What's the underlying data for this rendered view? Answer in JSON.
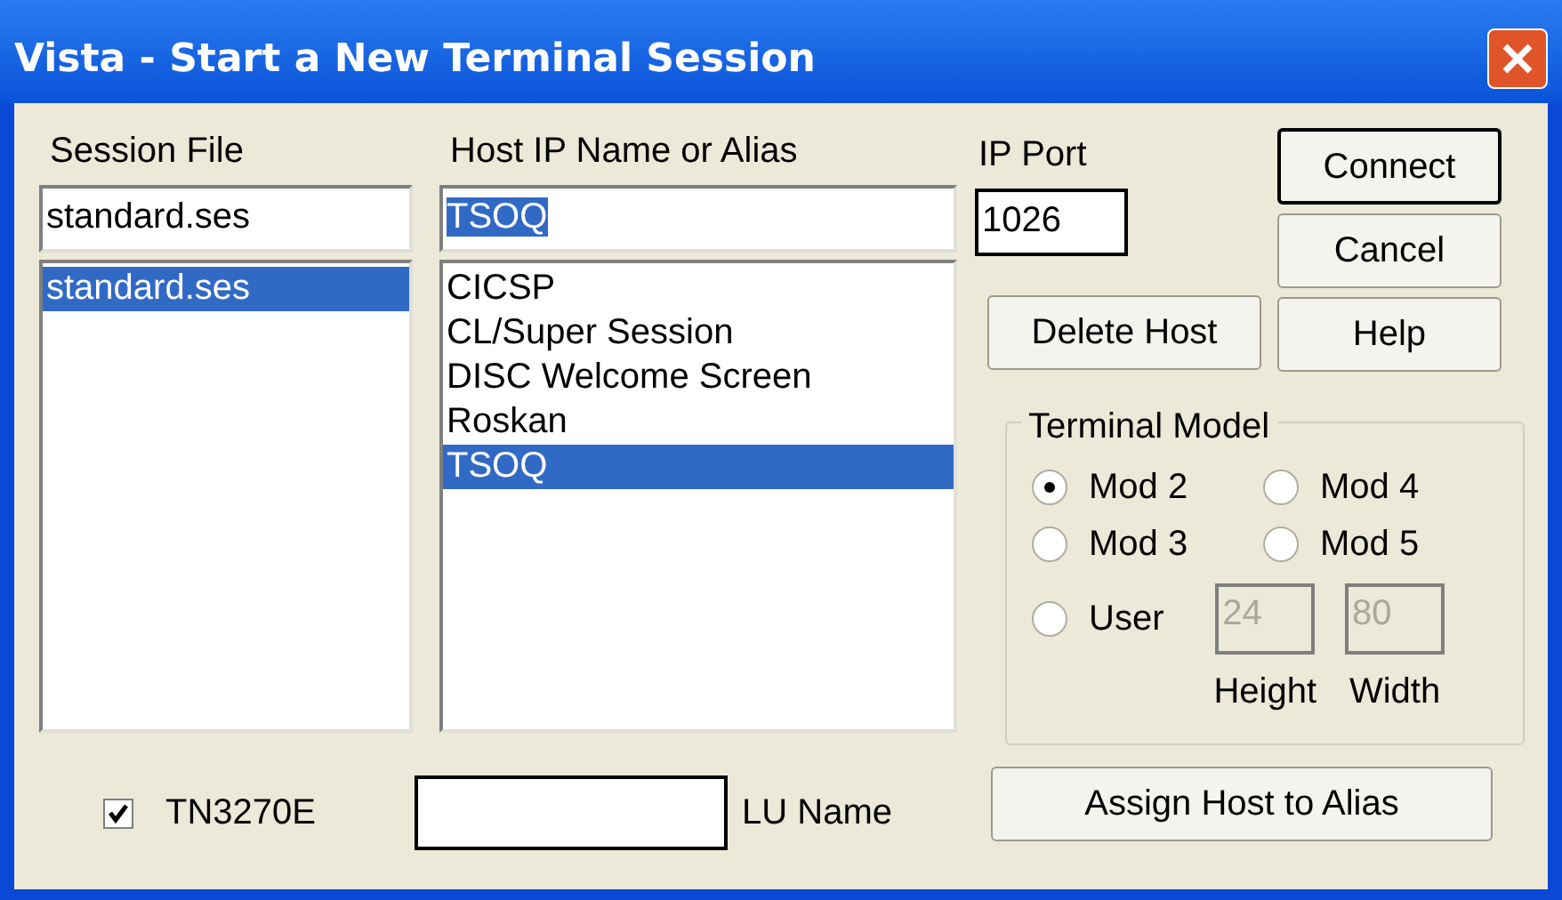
{
  "window": {
    "title": "Vista - Start a New Terminal Session"
  },
  "session_file": {
    "label": "Session File",
    "value": "standard.ses",
    "items": [
      {
        "label": "standard.ses",
        "selected": true
      }
    ]
  },
  "host": {
    "label": "Host IP Name or Alias",
    "value": "TSOQ",
    "value_selected": true,
    "items": [
      {
        "label": "CICSP",
        "selected": false
      },
      {
        "label": "CL/Super Session",
        "selected": false
      },
      {
        "label": "DISC Welcome Screen",
        "selected": false
      },
      {
        "label": "Roskan",
        "selected": false
      },
      {
        "label": "TSOQ",
        "selected": true
      }
    ]
  },
  "ip_port": {
    "label": "IP Port",
    "value": "1026"
  },
  "buttons": [
    {
      "label": "Connect",
      "default": true
    },
    {
      "label": "Cancel",
      "default": false
    },
    {
      "label": "Delete Host",
      "default": false
    },
    {
      "label": "Help",
      "default": false
    }
  ],
  "terminal_model": {
    "label": "Terminal Model",
    "options": [
      {
        "label": "Mod 2",
        "selected": true
      },
      {
        "label": "Mod 4",
        "selected": false
      },
      {
        "label": "Mod 3",
        "selected": false
      },
      {
        "label": "Mod 5",
        "selected": false
      },
      {
        "label": "User",
        "selected": false
      }
    ],
    "height": {
      "label": "Height",
      "value": "24",
      "disabled": true
    },
    "width": {
      "label": "Width",
      "value": "80",
      "disabled": true
    }
  },
  "tn3270e": {
    "label": "TN3270E",
    "checked": true
  },
  "lu_name": {
    "label": "LU Name"
  },
  "assign_button": {
    "label": "Assign Host to Alias"
  }
}
